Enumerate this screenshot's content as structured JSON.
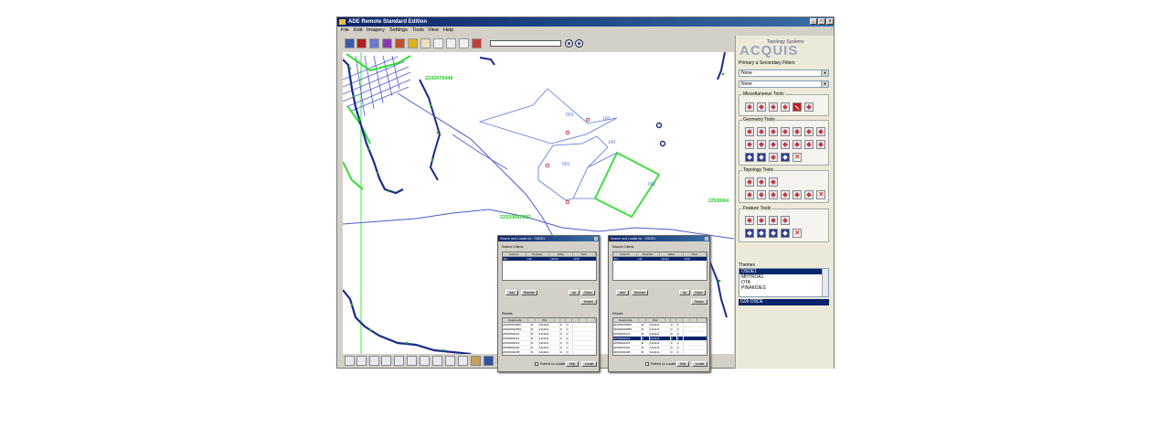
{
  "window": {
    "title": "ADE Remote Standard Edition",
    "controls": [
      "_",
      "□",
      "x"
    ]
  },
  "menu": [
    "File",
    "Edit",
    "Imagery",
    "Settings",
    "Tools",
    "View",
    "Help"
  ],
  "toolbar": {
    "search_value": "",
    "icons": [
      "open-icon",
      "save-icon",
      "layer-add-icon",
      "layer-remove-icon",
      "edit-icon",
      "lock-icon",
      "identify-icon",
      "select-icon",
      "undo-icon",
      "redo-icon",
      "print-icon"
    ],
    "go_icons": [
      "go-icon",
      "clear-icon"
    ]
  },
  "map": {
    "labels": [
      {
        "text": "2243076440",
        "color": "#22cc22"
      },
      {
        "text": "22530082622",
        "color": "#22cc22"
      },
      {
        "text": "003",
        "color": "#5577dd"
      },
      {
        "text": "100",
        "color": "#5577dd"
      },
      {
        "text": "140",
        "color": "#5577dd"
      },
      {
        "text": "001",
        "color": "#5577dd"
      },
      {
        "text": "002",
        "color": "#5577dd"
      },
      {
        "text": "22530064",
        "color": "#22cc22"
      }
    ]
  },
  "bottom_toolbar": [
    "zoom-in-icon",
    "zoom-out-icon",
    "zoom-extent-icon",
    "pan-left-icon",
    "pan-up-icon",
    "pan-down-icon",
    "pan-right-icon",
    "previous-extent-icon",
    "next-extent-icon",
    "measure-icon",
    "identify-icon",
    "map-icon"
  ],
  "panel": {
    "logo": {
      "subtitle": "Topology Systems",
      "name": "ACQUIS"
    },
    "filters_label": "Primary a Secondary Filters",
    "filter1": "None",
    "filter2": "None",
    "groups": {
      "misc": "Miscellaneous Tools",
      "geometry": "Geometry Tools",
      "topology": "Topology Tools",
      "feature": "Feature Tools"
    },
    "themes_label": "Themes",
    "themes": [
      "OSDE1",
      "MHTROA1",
      "OTA",
      "PINAKIDES"
    ],
    "current_theme": "G06:OSDE"
  },
  "dialogs": [
    {
      "title": "Search and Locate for : OSDE1",
      "criteria_label": "Search Criteria",
      "columns": [
        "Column",
        "Operator",
        "Value",
        "Next"
      ],
      "criteria_row": [
        "khv",
        "Like",
        "111111",
        "AND"
      ],
      "buttons": {
        "add": "Add",
        "remove": "Remove",
        "up": "Up",
        "down": "Down",
        "search": "Search",
        "help": "Help",
        "locate": "Locate"
      },
      "results_label": "Results",
      "result_cols": [
        "Kaerpcode",
        "",
        "Kkv",
        "",
        "",
        "",
        "",
        "",
        ""
      ],
      "results": [
        [
          "240025034862",
          "R",
          "1111111",
          "0",
          "3"
        ],
        [
          "240025092583",
          "R",
          "1111111",
          "0",
          "3"
        ],
        [
          "22530064213",
          "R",
          "1111111",
          "0",
          "2"
        ],
        [
          "22530064214",
          "R",
          "1111111",
          "0",
          "2"
        ],
        [
          "22530064215",
          "R",
          "1111111",
          "0",
          "3"
        ],
        [
          "22530064200",
          "R",
          "1111111",
          "0",
          "4"
        ],
        [
          "22530064208",
          "R",
          "1111111",
          "0",
          "3"
        ]
      ],
      "highlight_row": -1,
      "extend_label": "Extend on Locate"
    },
    {
      "title": "Search and Locate for : OSDE1",
      "criteria_label": "Search Criteria",
      "columns": [
        "Column",
        "Operator",
        "Value",
        "Next"
      ],
      "criteria_row": [
        "khv",
        "Like",
        "111111",
        "AND"
      ],
      "buttons": {
        "add": "Add",
        "remove": "Remove",
        "up": "Up",
        "down": "Down",
        "search": "Search",
        "help": "Help",
        "locate": "Locate"
      },
      "results_label": "Results",
      "result_cols": [
        "Kaerpcode",
        "",
        "Kkv",
        "",
        "",
        "",
        "",
        "",
        ""
      ],
      "results": [
        [
          "240025034862",
          "R",
          "1111111",
          "0",
          "3"
        ],
        [
          "240025092583",
          "R",
          "1111111",
          "0",
          "3"
        ],
        [
          "22530064213",
          "R",
          "1111111",
          "0",
          "2"
        ],
        [
          "22530064214",
          "R",
          "1111111",
          "0",
          "2"
        ],
        [
          "22530064215",
          "R",
          "1111111",
          "0",
          "3"
        ],
        [
          "22530064200",
          "R",
          "1111111",
          "0",
          "4"
        ],
        [
          "22530064208",
          "R",
          "1111111",
          "0",
          "3"
        ]
      ],
      "highlight_row": 3,
      "extend_label": "Extend on Locate"
    }
  ]
}
